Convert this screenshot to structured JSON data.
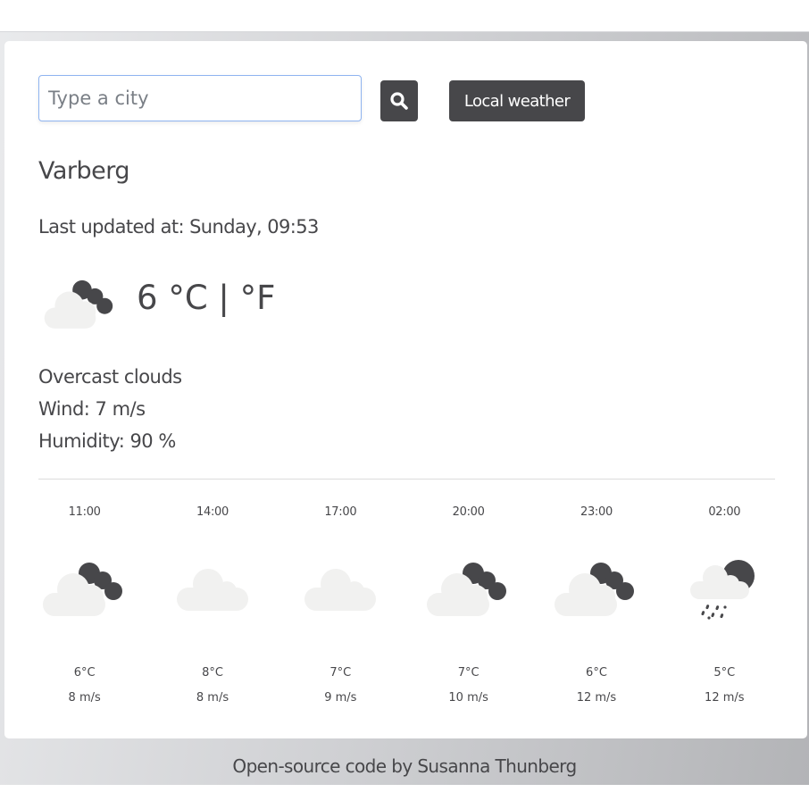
{
  "search": {
    "placeholder": "Type a city",
    "value": "",
    "search_icon": "search-icon"
  },
  "local_button": {
    "label": "Local weather"
  },
  "current": {
    "city": "Varberg",
    "last_updated": "Last updated at: Sunday, 09:53",
    "icon": "night-broken-clouds",
    "temperature": "6",
    "unit_c": "°C",
    "separator": "|",
    "unit_f": "°F",
    "description": "Overcast clouds",
    "wind": "Wind: 7 m/s",
    "humidity": "Humidity: 90 %"
  },
  "forecast": [
    {
      "time": "11:00",
      "icon": "night-broken-clouds",
      "temp": "6°C",
      "wind": "8 m/s"
    },
    {
      "time": "14:00",
      "icon": "cloud",
      "temp": "8°C",
      "wind": "8 m/s"
    },
    {
      "time": "17:00",
      "icon": "cloud",
      "temp": "7°C",
      "wind": "9 m/s"
    },
    {
      "time": "20:00",
      "icon": "night-broken-clouds",
      "temp": "7°C",
      "wind": "10 m/s"
    },
    {
      "time": "23:00",
      "icon": "night-broken-clouds",
      "temp": "6°C",
      "wind": "12 m/s"
    },
    {
      "time": "02:00",
      "icon": "night-rain",
      "temp": "5°C",
      "wind": "12 m/s"
    }
  ],
  "footer": {
    "link_text": "Open-source code",
    "by": " by ",
    "author": "Susanna Thunberg"
  },
  "colors": {
    "dark": "#47474a",
    "cloud_light": "#f1f1f0",
    "input_border": "#8fb4f0"
  }
}
